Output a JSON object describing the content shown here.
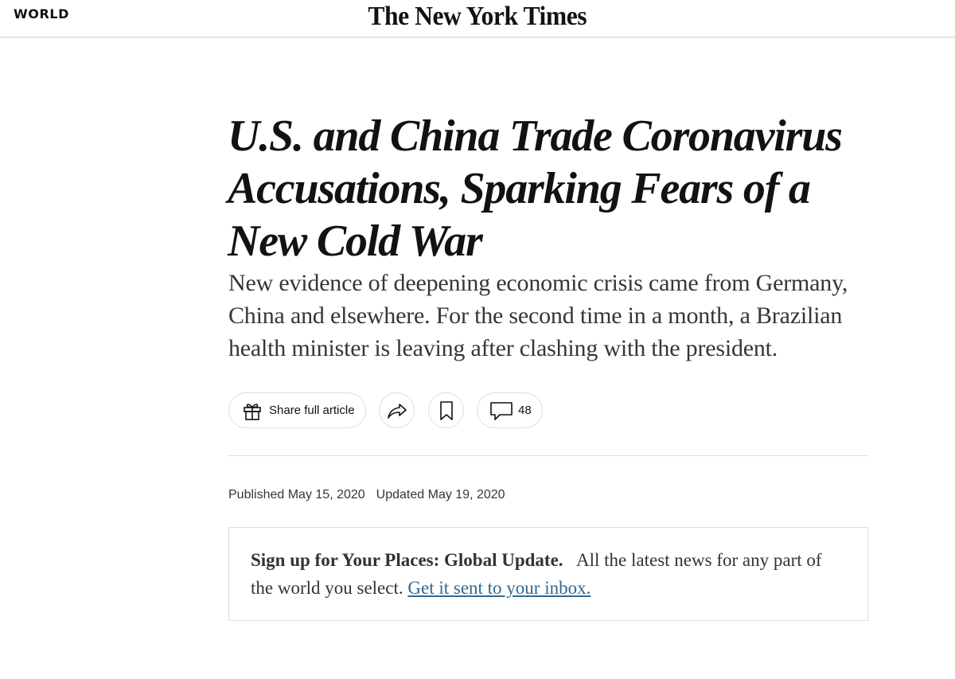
{
  "header": {
    "section": "WORLD",
    "masthead": "The New York Times"
  },
  "article": {
    "headline": "U.S. and China Trade Coronavirus Accusations, Sparking Fears of a New Cold War",
    "summary": "New evidence of deepening economic crisis came from Germany, China and elsewhere. For the second time in a month, a Brazilian health minister is leaving after clashing with the president.",
    "published": "Published May 15, 2020",
    "updated": "Updated May 19, 2020"
  },
  "actions": {
    "share_full_article_label": "Share full article",
    "share_icon": "gift-icon",
    "send_icon": "share-arrow-icon",
    "save_icon": "bookmark-icon",
    "comments_icon": "comment-icon",
    "comment_count": "48"
  },
  "newsletter": {
    "title": "Sign up for Your Places: Global Update.",
    "description": "All the latest news for any part of the world you select.",
    "link_text": "Get it sent to your inbox."
  },
  "colors": {
    "text": "#121212",
    "link": "#326891",
    "border": "#dfdfdf"
  }
}
